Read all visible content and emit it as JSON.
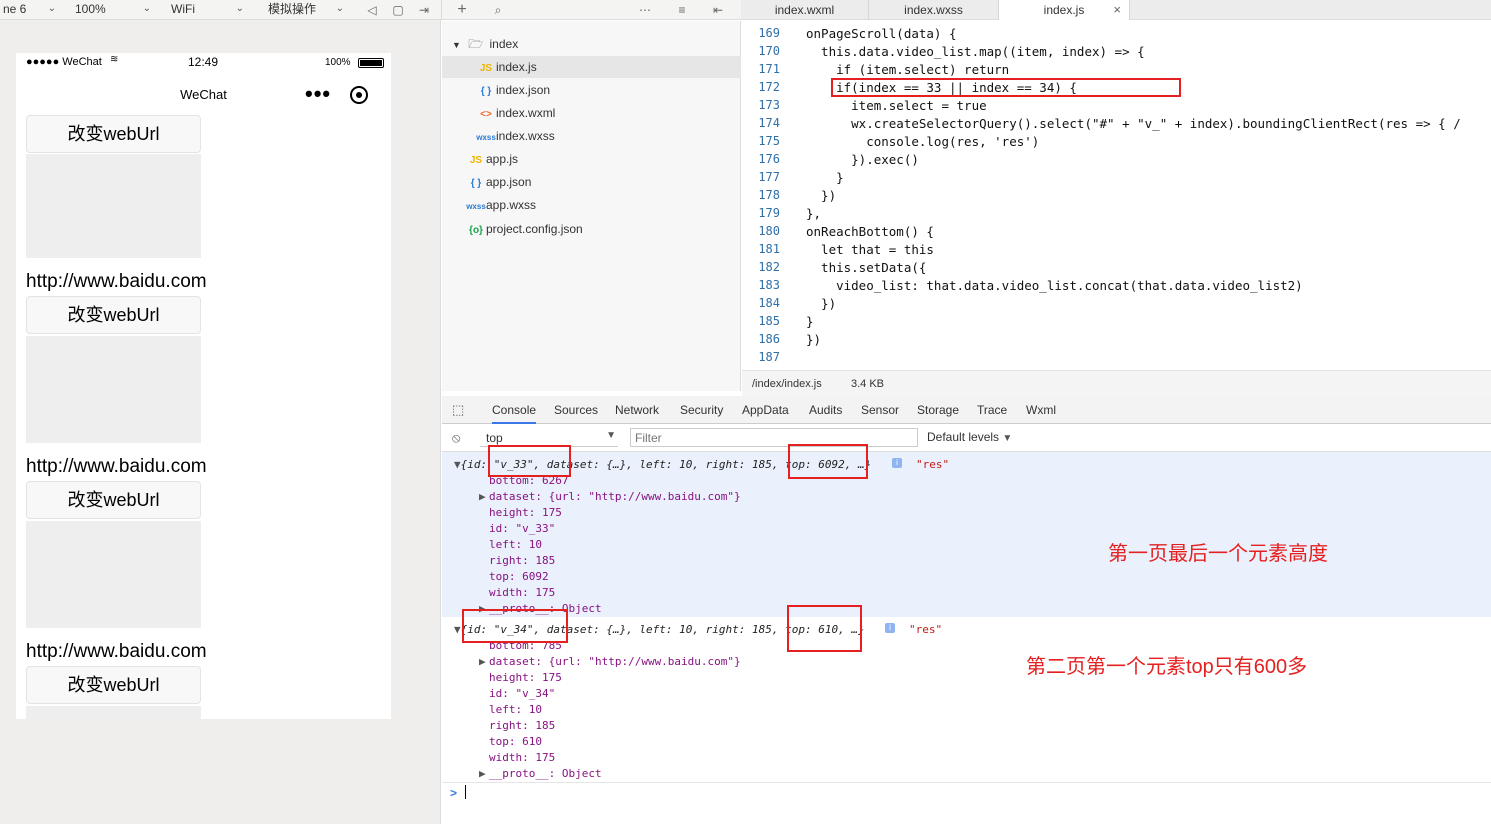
{
  "toolbar": {
    "device": "ne 6",
    "zoom": "100%",
    "network": "WiFi",
    "operation": "模拟操作"
  },
  "tabs": [
    {
      "label": "index.wxml"
    },
    {
      "label": "index.wxss"
    },
    {
      "label": "index.js"
    }
  ],
  "phone": {
    "carrier": "●●●●● WeChat",
    "time": "12:49",
    "battery": "100%",
    "title": "WeChat",
    "button_label": "改变webUrl",
    "url": "http://www.baidu.com"
  },
  "tree": {
    "folder": "index",
    "files": [
      {
        "icon": "JS",
        "name": "index.js"
      },
      {
        "icon": "{ }",
        "name": "index.json"
      },
      {
        "icon": "<>",
        "name": "index.wxml"
      },
      {
        "icon": "wxss",
        "name": "index.wxss"
      },
      {
        "icon": "JS",
        "name": "app.js"
      },
      {
        "icon": "{ }",
        "name": "app.json"
      },
      {
        "icon": "wxss",
        "name": "app.wxss"
      },
      {
        "icon": "{o}",
        "name": "project.config.json"
      }
    ]
  },
  "editor": {
    "lines": [
      {
        "n": "169",
        "code": "onPageScroll(data) {"
      },
      {
        "n": "170",
        "code": "  this.data.video_list.map((item, index) => {"
      },
      {
        "n": "171",
        "code": "    if (item.select) return"
      },
      {
        "n": "172",
        "code": "    if(index == 33 || index == 34) {"
      },
      {
        "n": "173",
        "code": "      item.select = true"
      },
      {
        "n": "174",
        "code": "      wx.createSelectorQuery().select(\"#\" + \"v_\" + index).boundingClientRect(res => { /"
      },
      {
        "n": "175",
        "code": "        console.log(res, 'res')"
      },
      {
        "n": "176",
        "code": "      }).exec()"
      },
      {
        "n": "177",
        "code": "    }"
      },
      {
        "n": "178",
        "code": "  })"
      },
      {
        "n": "179",
        "code": "},"
      },
      {
        "n": "180",
        "code": "onReachBottom() {"
      },
      {
        "n": "181",
        "code": "  let that = this"
      },
      {
        "n": "182",
        "code": "  this.setData({"
      },
      {
        "n": "183",
        "code": "    video_list: that.data.video_list.concat(that.data.video_list2)"
      },
      {
        "n": "184",
        "code": "  })"
      },
      {
        "n": "185",
        "code": "}"
      },
      {
        "n": "186",
        "code": "})"
      },
      {
        "n": "187",
        "code": ""
      }
    ],
    "path": "/index/index.js",
    "size": "3.4 KB"
  },
  "devtools": {
    "tabs": [
      "Console",
      "Sources",
      "Network",
      "Security",
      "AppData",
      "Audits",
      "Sensor",
      "Storage",
      "Trace",
      "Wxml"
    ],
    "context": "top",
    "filter_placeholder": "Filter",
    "levels": "Default levels"
  },
  "console": {
    "entry1": {
      "summary": "{id: \"v_33\", dataset: {…}, left: 10, right: 185, top: 6092, …}",
      "tag": "\"res\"",
      "props": [
        "bottom: 6267",
        "dataset: {url: \"http://www.baidu.com\"}",
        "height: 175",
        "id: \"v_33\"",
        "left: 10",
        "right: 185",
        "top: 6092",
        "width: 175",
        "__proto__: Object"
      ]
    },
    "entry2": {
      "summary": "{id: \"v_34\", dataset: {…}, left: 10, right: 185, top: 610, …}",
      "tag": "\"res\"",
      "props": [
        "bottom: 785",
        "dataset: {url: \"http://www.baidu.com\"}",
        "height: 175",
        "id: \"v_34\"",
        "left: 10",
        "right: 185",
        "top: 610",
        "width: 175",
        "__proto__: Object"
      ]
    },
    "annotation1": "第一页最后一个元素高度",
    "annotation2": "第二页第一个元素top只有600多",
    "prompt": ">"
  },
  "colors": {
    "highlight_box": "#e52020",
    "selected_row": "#eaf0fc",
    "active_tab": "#3b78e7"
  }
}
